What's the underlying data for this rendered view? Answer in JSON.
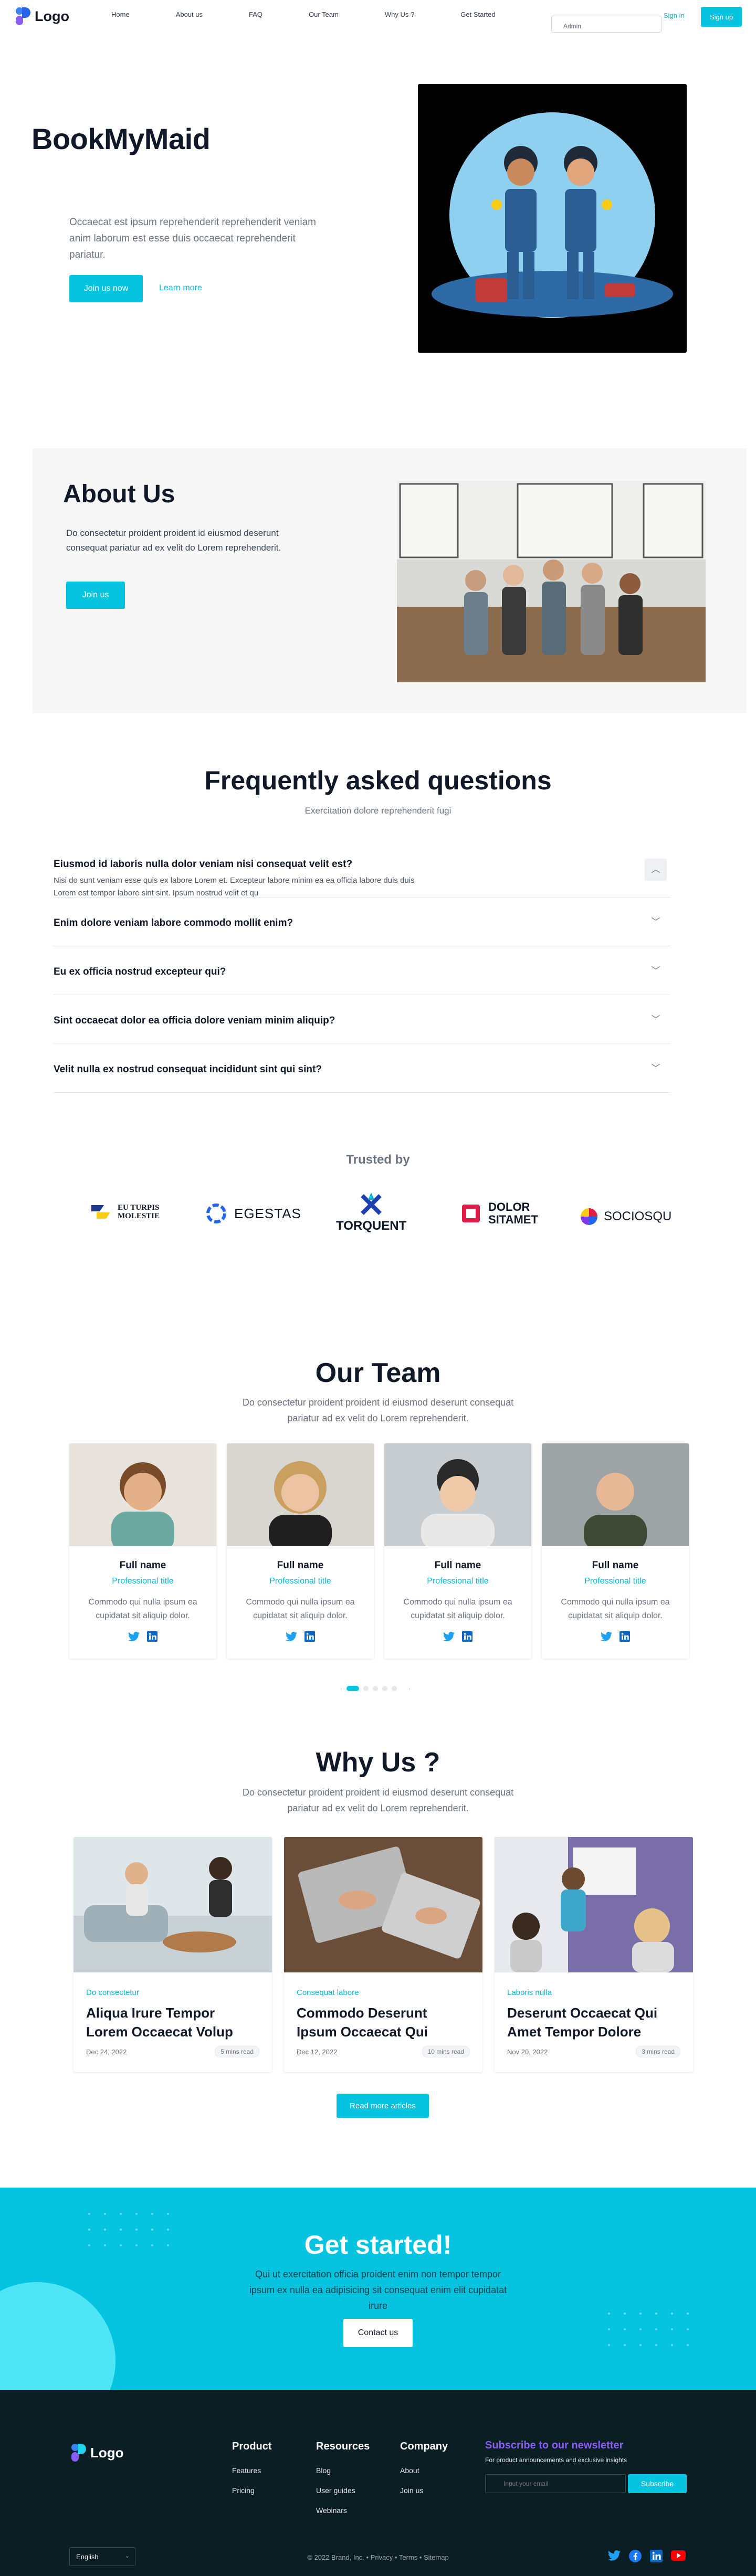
{
  "nav": {
    "logo": "Logo",
    "links": [
      "Home",
      "About us",
      "FAQ",
      "Our Team",
      "Why Us ?",
      "Get Started"
    ],
    "search_placeholder": "Admin",
    "signin": "Sign in",
    "signup": "Sign up"
  },
  "hero": {
    "title": "BookMyMaid",
    "subtitle": "Occaecat est ipsum reprehenderit reprehenderit veniam anim laborum est esse duis occaecat reprehenderit pariatur.",
    "cta": "Join us now",
    "learn_more": "Learn more"
  },
  "about": {
    "title": "About Us",
    "text": "Do consectetur proident proident id eiusmod deserunt consequat pariatur ad ex velit do Lorem reprehenderit.",
    "cta": "Join us"
  },
  "faq": {
    "title": "Frequently asked questions",
    "subtitle": "Exercitation dolore reprehenderit fugi",
    "items": [
      {
        "q": "Eiusmod id laboris nulla dolor veniam nisi consequat velit est?",
        "a": "Nisi do sunt veniam esse quis ex labore Lorem et. Excepteur labore minim ea ea officia labore duis duis Lorem est tempor labore sint sint. Ipsum nostrud velit et qu"
      },
      {
        "q": "Enim dolore veniam labore commodo mollit enim?",
        "a": ""
      },
      {
        "q": "Eu ex officia nostrud excepteur qui?",
        "a": ""
      },
      {
        "q": "Sint occaecat dolor ea officia dolore veniam minim aliquip?",
        "a": ""
      },
      {
        "q": "Velit nulla ex nostrud consequat incididunt sint qui sint?",
        "a": ""
      }
    ]
  },
  "trusted": {
    "title": "Trusted by",
    "logos": [
      {
        "line1": "EU TURPIS",
        "line2": "MOLESTIE"
      },
      {
        "line1": "EGESTAS",
        "line2": ""
      },
      {
        "line1": "TORQUENT",
        "line2": ""
      },
      {
        "line1": "DOLOR",
        "line2": "SITAMET"
      },
      {
        "line1": "SOCIOSQU",
        "line2": ""
      }
    ]
  },
  "team": {
    "title": "Our Team",
    "subtitle_line1": "Do consectetur proident proident id eiusmod deserunt consequat",
    "subtitle_line2": "pariatur ad ex velit do Lorem reprehenderit.",
    "members": [
      {
        "name": "Full name",
        "role": "Professional title",
        "desc": "Commodo qui nulla ipsum ea cupidatat sit aliquip dolor."
      },
      {
        "name": "Full name",
        "role": "Professional title",
        "desc": "Commodo qui nulla ipsum ea cupidatat sit aliquip dolor."
      },
      {
        "name": "Full name",
        "role": "Professional title",
        "desc": "Commodo qui nulla ipsum ea cupidatat sit aliquip dolor."
      },
      {
        "name": "Full name",
        "role": "Professional title",
        "desc": "Commodo qui nulla ipsum ea cupidatat sit aliquip dolor."
      }
    ]
  },
  "why": {
    "title": "Why Us ?",
    "subtitle_line1": "Do consectetur proident proident id eiusmod deserunt consequat",
    "subtitle_line2": "pariatur ad ex velit do Lorem reprehenderit.",
    "posts": [
      {
        "tag": "Do consectetur",
        "title": "Aliqua Irure Tempor Lorem Occaecat Volup",
        "date": "Dec 24, 2022",
        "read": "5 mins read"
      },
      {
        "tag": "Consequat labore",
        "title": "Commodo Deserunt Ipsum Occaecat Qui",
        "date": "Dec 12, 2022",
        "read": "10 mins read"
      },
      {
        "tag": "Laboris nulla",
        "title": "Deserunt Occaecat Qui Amet Tempor Dolore",
        "date": "Nov 20, 2022",
        "read": "3 mins read"
      }
    ],
    "cta": "Read more articles"
  },
  "get_started": {
    "title": "Get started!",
    "text": "Qui ut exercitation officia proident enim non tempor tempor ipsum ex nulla ea adipisicing sit consequat enim elit cupidatat irure",
    "cta": "Contact us"
  },
  "footer": {
    "logo": "Logo",
    "columns": [
      {
        "title": "Product",
        "links": [
          "Features",
          "Pricing"
        ]
      },
      {
        "title": "Resources",
        "links": [
          "Blog",
          "User guides",
          "Webinars"
        ]
      },
      {
        "title": "Company",
        "links": [
          "About",
          "Join us"
        ]
      }
    ],
    "newsletter_title": "Subscribe to our newsletter",
    "newsletter_sub": "For product announcements and exclusive insights",
    "email_placeholder": "Input your email",
    "subscribe": "Subscribe",
    "language": "English",
    "copyright": "© 2022 Brand, Inc. • Privacy • Terms • Sitemap"
  },
  "colors": {
    "accent": "#06c4e0",
    "dark": "#0b1e24",
    "purple": "#8b5cf6"
  }
}
